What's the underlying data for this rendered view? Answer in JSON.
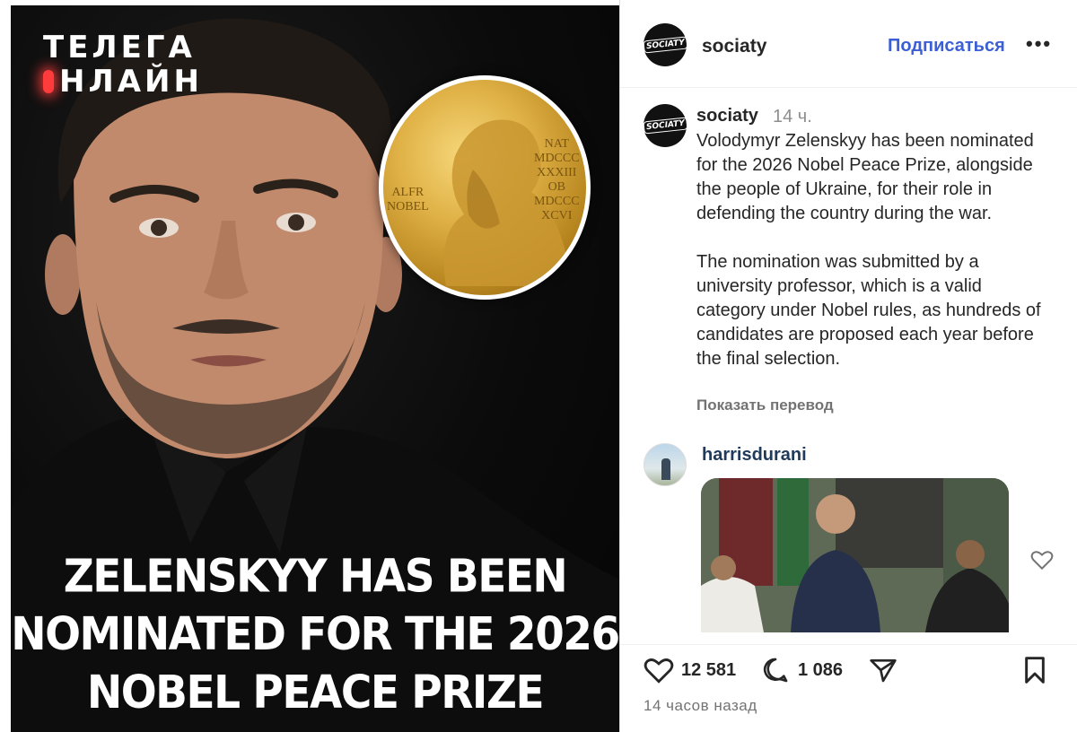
{
  "image": {
    "watermark_line1": "ТЕЛЕГА",
    "watermark_line2": "НЛАЙН",
    "medal_left": "ALFR\nNOBEL",
    "medal_right": "NAT\nMDCCC\nXXXIII\nOB\nMDCCC\nXCVI",
    "headline_lines": [
      "ZELENSKYY HAS BEEN",
      "NOMINATED FOR THE 2026",
      "NOBEL PEACE PRIZE"
    ]
  },
  "header": {
    "avatar_text": "SOCIATY",
    "username": "sociaty",
    "follow_label": "Подписаться",
    "more_label": "•••"
  },
  "caption": {
    "username": "sociaty",
    "time": "14 ч.",
    "paragraph1": "Volodymyr Zelenskyy has been nominated for the 2026 Nobel Peace Prize, alongside the people of Ukraine, for their role in defending the country during the war.",
    "paragraph2": "The nomination was submitted by a university professor, which is a valid category under Nobel rules, as hundreds of candidates are proposed each year before the final selection.",
    "translate_label": "Показать перевод"
  },
  "comment": {
    "username": "harrisdurani"
  },
  "actions": {
    "likes": "12 581",
    "comments": "1 086",
    "time_ago": "14 часов назад"
  }
}
